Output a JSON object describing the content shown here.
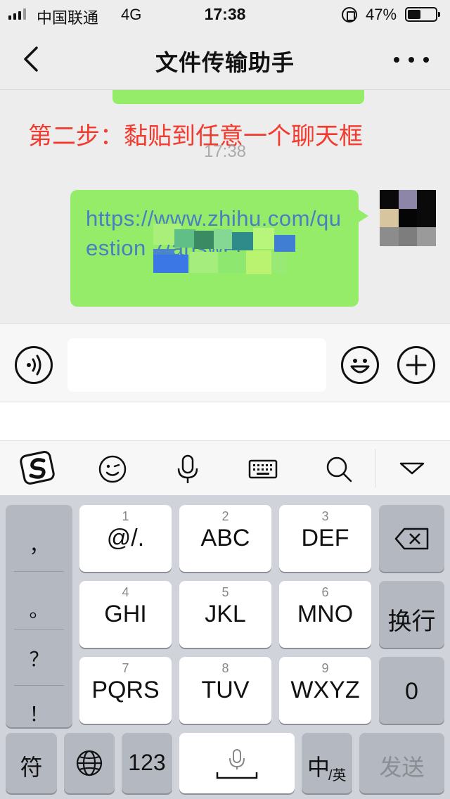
{
  "status_bar": {
    "carrier": "中国联通",
    "network": "4G",
    "time": "17:38",
    "battery_text": "47%",
    "battery_level": 0.47
  },
  "nav": {
    "title": "文件传输助手"
  },
  "chat": {
    "caption": "第二步：黏贴到任意一个聊天框",
    "timestamp": "17:38",
    "message": "https://www.zhihu.com/question          7/answer"
  },
  "toolbar": {
    "icons": [
      "sogou-logo-icon",
      "emoji-face-icon",
      "microphone-icon",
      "keyboard-icon",
      "search-icon",
      "collapse-triangle-icon"
    ]
  },
  "keyboard": {
    "punctuation": [
      "，",
      "。",
      "？",
      "！"
    ],
    "rows": [
      [
        {
          "num": "1",
          "label": "@/."
        },
        {
          "num": "2",
          "label": "ABC"
        },
        {
          "num": "3",
          "label": "DEF"
        }
      ],
      [
        {
          "num": "4",
          "label": "GHI"
        },
        {
          "num": "5",
          "label": "JKL"
        },
        {
          "num": "6",
          "label": "MNO"
        }
      ],
      [
        {
          "num": "7",
          "label": "PQRS"
        },
        {
          "num": "8",
          "label": "TUV"
        },
        {
          "num": "9",
          "label": "WXYZ"
        }
      ]
    ],
    "newline_label": "换行",
    "zero_label": "0",
    "symbols_label": "符",
    "numbers_label": "123",
    "lang_main": "中",
    "lang_sub": "/英",
    "send_label": "发送"
  },
  "colors": {
    "bubble": "#95ec69",
    "caption": "#f23b2e",
    "link": "#4a7dc4",
    "keyboard_bg": "#d0d3d9"
  }
}
